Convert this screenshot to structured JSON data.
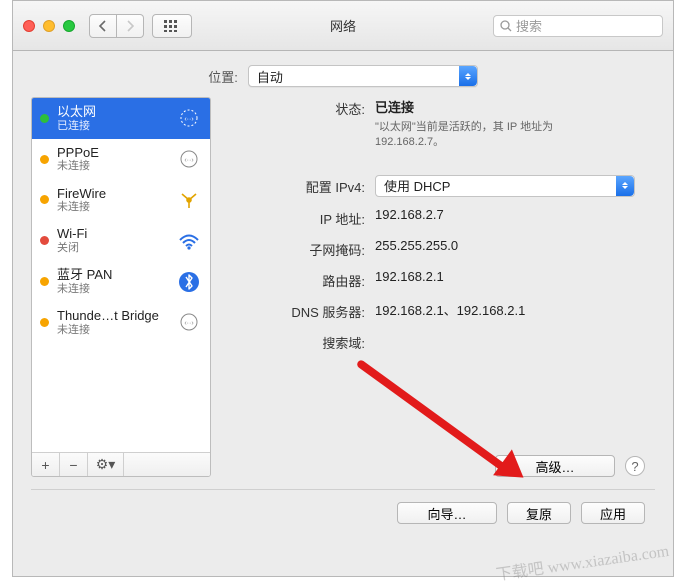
{
  "toolbar": {
    "title": "网络",
    "search_placeholder": "搜索"
  },
  "location": {
    "label": "位置:",
    "value": "自动"
  },
  "services": [
    {
      "name": "以太网",
      "status": "已连接",
      "dot": "green",
      "selected": true,
      "icon": "ethernet"
    },
    {
      "name": "PPPoE",
      "status": "未连接",
      "dot": "orange",
      "icon": "ethernet"
    },
    {
      "name": "FireWire",
      "status": "未连接",
      "dot": "orange",
      "icon": "firewire"
    },
    {
      "name": "Wi-Fi",
      "status": "关闭",
      "dot": "red",
      "icon": "wifi"
    },
    {
      "name": "蓝牙 PAN",
      "status": "未连接",
      "dot": "orange",
      "icon": "bluetooth"
    },
    {
      "name": "Thunde…t Bridge",
      "status": "未连接",
      "dot": "orange",
      "icon": "ethernet"
    }
  ],
  "sidebar_buttons": {
    "add": "+",
    "remove": "−",
    "gear": "⚙︎▾"
  },
  "details": {
    "status_label": "状态:",
    "status_value": "已连接",
    "status_desc": "\"以太网\"当前是活跃的，其 IP 地址为 192.168.2.7。",
    "ipv4_label": "配置 IPv4:",
    "ipv4_value": "使用 DHCP",
    "ip_label": "IP 地址:",
    "ip_value": "192.168.2.7",
    "mask_label": "子网掩码:",
    "mask_value": "255.255.255.0",
    "router_label": "路由器:",
    "router_value": "192.168.2.1",
    "dns_label": "DNS 服务器:",
    "dns_value": "192.168.2.1、192.168.2.1",
    "search_label": "搜索域:",
    "search_value": ""
  },
  "buttons": {
    "advanced": "高级…",
    "help": "?",
    "assist": "向导…",
    "revert": "复原",
    "apply": "应用"
  },
  "watermark": "下载吧 www.xiazaiba.com"
}
